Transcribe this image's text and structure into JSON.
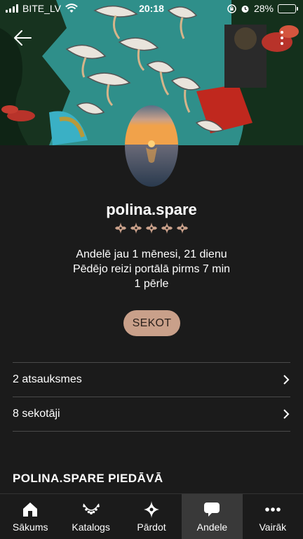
{
  "status_bar": {
    "carrier": "BITE_LV",
    "time": "20:18",
    "battery": "28%",
    "battery_level": 0.28
  },
  "profile": {
    "username": "polina.spare",
    "rating_stars": 5,
    "member_since": "Andelē jau 1 mēnesi, 21 dienu",
    "last_seen": "Pēdējo reizi portālā pirms 7 min",
    "pearls": "1 pērle",
    "follow_label": "SEKOT"
  },
  "list": [
    {
      "label": "2 atsauksmes"
    },
    {
      "label": "8 sekotāji"
    }
  ],
  "section_title": "POLINA.SPARE PIEDĀVĀ",
  "tabs": [
    {
      "label": "Sākums",
      "icon": "home-icon"
    },
    {
      "label": "Katalogs",
      "icon": "necklace-icon"
    },
    {
      "label": "Pārdot",
      "icon": "sparkle-icon"
    },
    {
      "label": "Andele",
      "icon": "chat-icon",
      "active": true
    },
    {
      "label": "Vairāk",
      "icon": "more-dots-icon"
    }
  ],
  "colors": {
    "background": "#1b1b1b",
    "accent": "#c9a08a",
    "cover_teal": "#2f8f8a",
    "active_tab": "#393939"
  }
}
